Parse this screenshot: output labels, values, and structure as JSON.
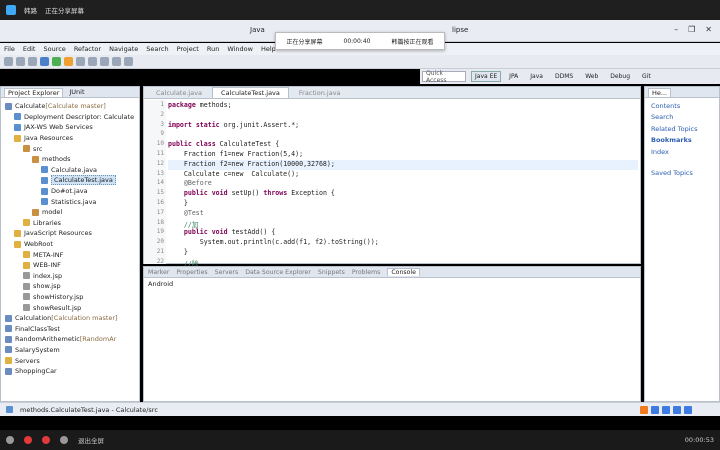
{
  "meeting": {
    "app_name": "韩路",
    "status": "正在分享屏幕",
    "share_label": "正在分享屏幕",
    "share_time": "00:00:40",
    "share_hint": "韩篇按正在观看",
    "exit_fullscreen": "退出全屏",
    "bottom_time": "00:00:53"
  },
  "window": {
    "title_left": "Java",
    "title_right": "lipse"
  },
  "menu": [
    "File",
    "Edit",
    "Source",
    "Refactor",
    "Navigate",
    "Search",
    "Project",
    "Run",
    "Window",
    "Help"
  ],
  "perspectives": {
    "quick_access": "Quick Access",
    "items": [
      "Java EE",
      "JPA",
      "Java",
      "DDMS",
      "Web",
      "Debug",
      "Git"
    ],
    "active": "Java EE"
  },
  "left_panel": {
    "tabs": [
      "Project Explorer",
      "JUnit"
    ],
    "tree": [
      {
        "label": "Calculate",
        "extra": "[Calculate master]",
        "indent": 0,
        "icon": "proj"
      },
      {
        "label": "Deployment Descriptor: Calculate",
        "extra": "",
        "indent": 1,
        "icon": "file"
      },
      {
        "label": "JAX-WS Web Services",
        "extra": "",
        "indent": 1,
        "icon": "file"
      },
      {
        "label": "Java Resources",
        "extra": "",
        "indent": 1,
        "icon": "fold"
      },
      {
        "label": "src",
        "extra": "",
        "indent": 2,
        "icon": "pkg"
      },
      {
        "label": "methods",
        "extra": "",
        "indent": 3,
        "icon": "pkg"
      },
      {
        "label": "Calculate.java",
        "extra": "",
        "indent": 4,
        "icon": "file"
      },
      {
        "label": "CalculateTest.java",
        "extra": "",
        "indent": 4,
        "icon": "file",
        "selected": true
      },
      {
        "label": "Do#ot.java",
        "extra": "",
        "indent": 4,
        "icon": "file"
      },
      {
        "label": "Statistics.java",
        "extra": "",
        "indent": 4,
        "icon": "file"
      },
      {
        "label": "model",
        "extra": "",
        "indent": 3,
        "icon": "pkg"
      },
      {
        "label": "Libraries",
        "extra": "",
        "indent": 2,
        "icon": "fold"
      },
      {
        "label": "JavaScript Resources",
        "extra": "",
        "indent": 1,
        "icon": "fold"
      },
      {
        "label": "WebRoot",
        "extra": "",
        "indent": 1,
        "icon": "fold"
      },
      {
        "label": "META-INF",
        "extra": "",
        "indent": 2,
        "icon": "fold"
      },
      {
        "label": "WEB-INF",
        "extra": "",
        "indent": 2,
        "icon": "fold"
      },
      {
        "label": "index.jsp",
        "extra": "",
        "indent": 2,
        "icon": "jsp"
      },
      {
        "label": "show.jsp",
        "extra": "",
        "indent": 2,
        "icon": "jsp"
      },
      {
        "label": "showHistory.jsp",
        "extra": "",
        "indent": 2,
        "icon": "jsp"
      },
      {
        "label": "showResult.jsp",
        "extra": "",
        "indent": 2,
        "icon": "jsp"
      },
      {
        "label": "Calculation",
        "extra": "[Calculation master]",
        "indent": 0,
        "icon": "proj"
      },
      {
        "label": "FinalClassTest",
        "extra": "",
        "indent": 0,
        "icon": "proj"
      },
      {
        "label": "RandomArithemetic",
        "extra": "[RandomAr",
        "indent": 0,
        "icon": "proj"
      },
      {
        "label": "SalarySystem",
        "extra": "",
        "indent": 0,
        "icon": "proj"
      },
      {
        "label": "Servers",
        "extra": "",
        "indent": 0,
        "icon": "fold"
      },
      {
        "label": "ShoppingCar",
        "extra": "",
        "indent": 0,
        "icon": "proj"
      }
    ]
  },
  "editor": {
    "tabs": [
      "Calculate.java",
      "CalculateTest.java",
      "Fraction.java"
    ],
    "active_tab": "CalculateTest.java",
    "lines": [
      {
        "n": "1",
        "t": "package methods;",
        "cls": ""
      },
      {
        "n": "2",
        "t": "",
        "cls": ""
      },
      {
        "n": "3",
        "t": "import static org.junit.Assert.*;",
        "cls": ""
      },
      {
        "n": "9",
        "t": "",
        "cls": ""
      },
      {
        "n": "10",
        "t": "public class CalculateTest {",
        "cls": ""
      },
      {
        "n": "11",
        "t": "    Fraction f1=new Fraction(5,4);",
        "cls": ""
      },
      {
        "n": "12",
        "t": "    Fraction f2=new Fraction(10000,32768);",
        "cls": "hl"
      },
      {
        "n": "13",
        "t": "    Calculate c=new  Calculate();",
        "cls": ""
      },
      {
        "n": "14",
        "t": "    @Before",
        "cls": ""
      },
      {
        "n": "15",
        "t": "    public void setUp() throws Exception {",
        "cls": ""
      },
      {
        "n": "16",
        "t": "    }",
        "cls": ""
      },
      {
        "n": "17",
        "t": "    @Test",
        "cls": ""
      },
      {
        "n": "18",
        "t": "    //加",
        "cls": ""
      },
      {
        "n": "19",
        "t": "    public void testAdd() {",
        "cls": ""
      },
      {
        "n": "20",
        "t": "        System.out.println(c.add(f1, f2).toString());",
        "cls": ""
      },
      {
        "n": "21",
        "t": "    }",
        "cls": ""
      },
      {
        "n": "22",
        "t": "    //除",
        "cls": ""
      }
    ]
  },
  "console": {
    "tabs": [
      "Marker",
      "Properties",
      "Servers",
      "Data Source Explorer",
      "Snippets",
      "Problems",
      "Console"
    ],
    "active_tab": "Console",
    "output": "Android"
  },
  "right_panel": {
    "tab": "He...",
    "items": [
      {
        "label": "Contents",
        "bold": false
      },
      {
        "label": "Search",
        "bold": false
      },
      {
        "label": "Related Topics",
        "bold": false
      },
      {
        "label": "Bookmarks",
        "bold": true
      },
      {
        "label": "Index",
        "bold": false
      }
    ],
    "saved": "Saved Topics"
  },
  "status": {
    "text": "methods.CalculateTest.java - Calculate/src"
  }
}
